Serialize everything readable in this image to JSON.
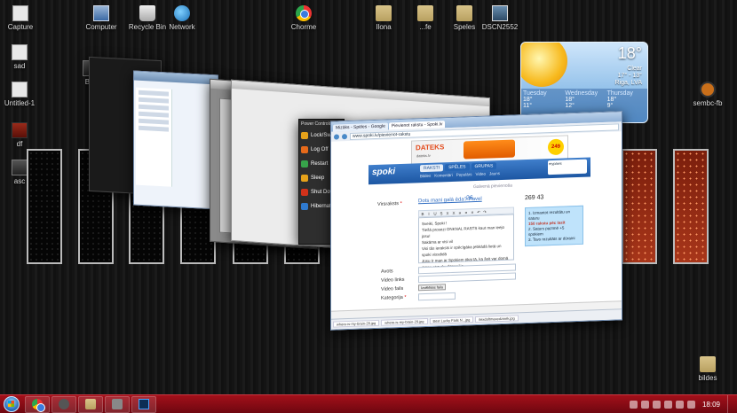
{
  "desktop": {
    "icons_top": [
      {
        "label": "Capture"
      },
      {
        "label": "Computer"
      },
      {
        "label": "Recycle Bin"
      },
      {
        "label": "Network"
      },
      {
        "label": "Chorme"
      },
      {
        "label": "Ilona"
      },
      {
        "label": "...fe"
      },
      {
        "label": "Speles"
      },
      {
        "label": "DSCN2552"
      }
    ],
    "icons_left": [
      {
        "label": "sad"
      },
      {
        "label": "Untitled-1"
      },
      {
        "label": "df"
      },
      {
        "label": "asc"
      }
    ],
    "partial_label": "Bre",
    "icons_right": [
      {
        "label": "sembc-fb"
      },
      {
        "label": "bildes"
      }
    ]
  },
  "weather": {
    "temp": "18°",
    "condition": "Clear",
    "range": "17° - 13°",
    "location": "Riga, LVA",
    "days": [
      {
        "name": "Tuesday",
        "high": "18°",
        "low": "11°"
      },
      {
        "name": "Wednesday",
        "high": "18°",
        "low": "12°"
      },
      {
        "name": "Thursday",
        "high": "18°",
        "low": "9°"
      }
    ]
  },
  "power_menu": {
    "title": "Power Controls",
    "items": [
      "Lock/Sw",
      "Log Off",
      "Restart",
      "Sleep",
      "Shut Dow",
      "Hibernat"
    ]
  },
  "browser": {
    "tabs": [
      "Mizāks - Spēles - Google",
      "Pievienot rakstu - Spoki.lv"
    ],
    "url": "www.spoki.lv/pievienot-rakstu",
    "ad": {
      "logo": "DATEKS",
      "sub": "dateks.lv",
      "price": "249"
    },
    "site": {
      "logo": "spoki",
      "tabs": [
        "RAKSTI",
        "SPĒLES",
        "GRUPAS"
      ],
      "subnav": [
        "Bildes",
        "Komentāri",
        "Populārs",
        "Video",
        "Jauns"
      ],
      "user": "mypaws"
    },
    "crumb": "Galvenā pievienoša",
    "form": {
      "title_label": "Virsraksts",
      "title_value": "Dots mani galā ēda? Pavel",
      "counter": "26",
      "toolbar": [
        "B",
        "I",
        "U",
        "S",
        "X",
        "X",
        "≡",
        "≡",
        "≡",
        "↶",
        "↷"
      ],
      "body_lines": [
        "Sveiki, Spoki !",
        "Tiešā prosezi ONKNAL RASTS kaut man ieejo jūsu!",
        "Sakāma ar visi vil",
        "Visi tās ieraksts ir spēcīgāka jebkādā lietā un spoki vissdidā",
        "Jūsu Ir man ar Spokiem tikai tā, ka šeit var domā mans otra daudzpanējs"
      ],
      "chars": "269   43",
      "info": [
        "1. Izmantot rezultātu un saturu",
        "150 rakstu pēc lasīt",
        "2. Saturs pazīmē +5 spokiem",
        "3. Tavs rezultāts ar dūraini"
      ],
      "field_labels": [
        "Avots",
        "Video links",
        "Video fails",
        "Kategorija"
      ],
      "upload_label": "Izvēlēties failu"
    },
    "downloads": [
      "where-is-my-brain-28.jpg",
      "where-is-my-brain-29.jpg",
      "Best Lucky Fails N...jpg",
      "ilexdaftmaxedzinek.jpg"
    ]
  },
  "taskbar": {
    "clock": "18:09"
  }
}
